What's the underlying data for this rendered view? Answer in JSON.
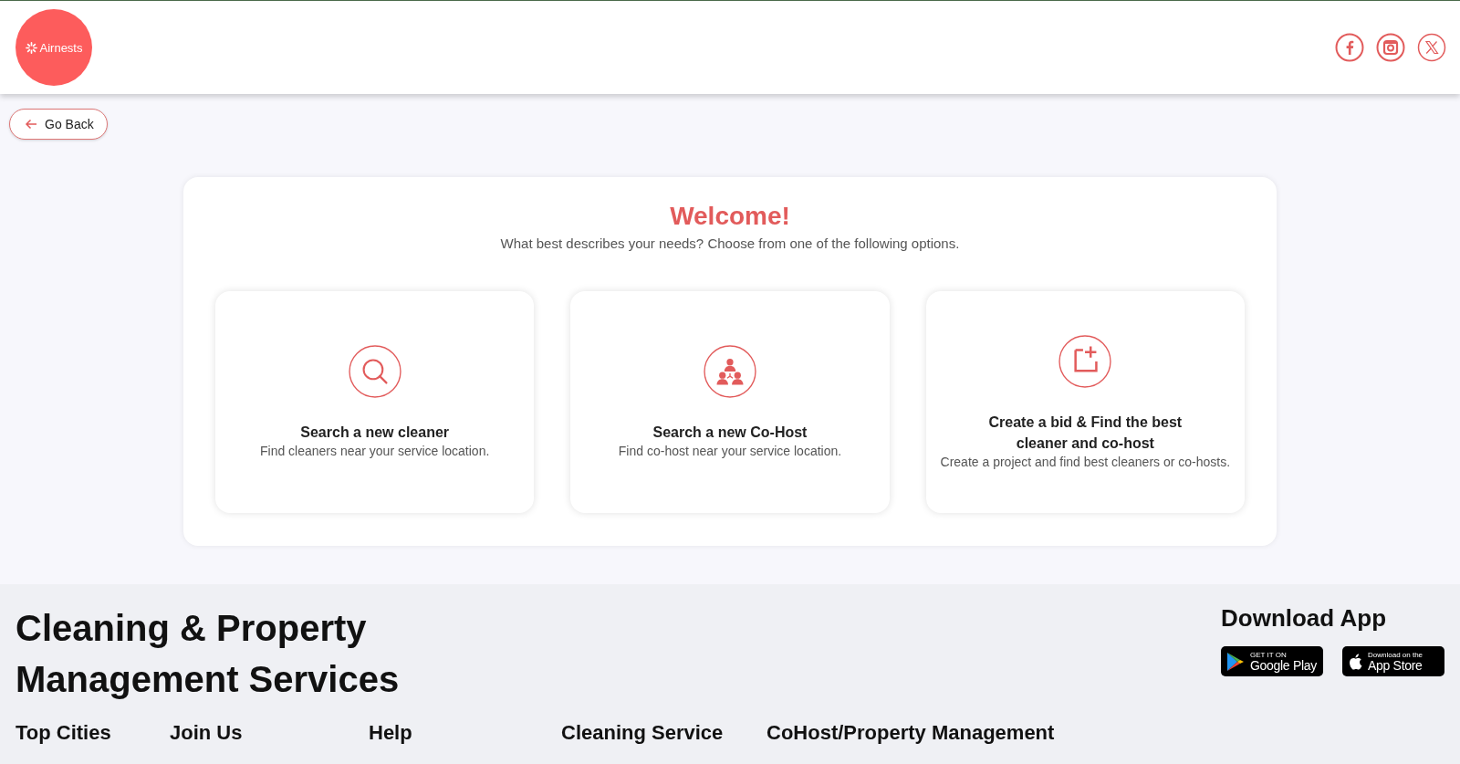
{
  "header": {
    "logo": "Airnests",
    "social": [
      {
        "kind": "facebook"
      },
      {
        "kind": "instagram"
      },
      {
        "kind": "x"
      }
    ]
  },
  "back_button": {
    "label": "Go Back"
  },
  "welcome": {
    "title": "Welcome!",
    "subtitle": "What best describes your needs? Choose from one of the following options.",
    "options": [
      {
        "kind": "search",
        "title": "Search a new cleaner",
        "description": "Find cleaners near your service location."
      },
      {
        "kind": "people",
        "title": "Search a new Co-Host",
        "description": "Find co-host near your service location."
      },
      {
        "kind": "add",
        "title": "Create a bid & Find the best cleaner and co-host",
        "description": "Create a project and find best cleaners or co-hosts."
      }
    ]
  },
  "footer": {
    "title": "Cleaning & Property Management Services",
    "download": {
      "title": "Download App",
      "badges": [
        {
          "kind": "google",
          "small": "GET IT ON",
          "big": "Google Play"
        },
        {
          "kind": "apple",
          "small": "Download on the",
          "big": "App Store"
        }
      ]
    },
    "columns": [
      "Top Cities",
      "Join Us",
      "Help",
      "Cleaning Service",
      "CoHost/Property Management"
    ]
  }
}
